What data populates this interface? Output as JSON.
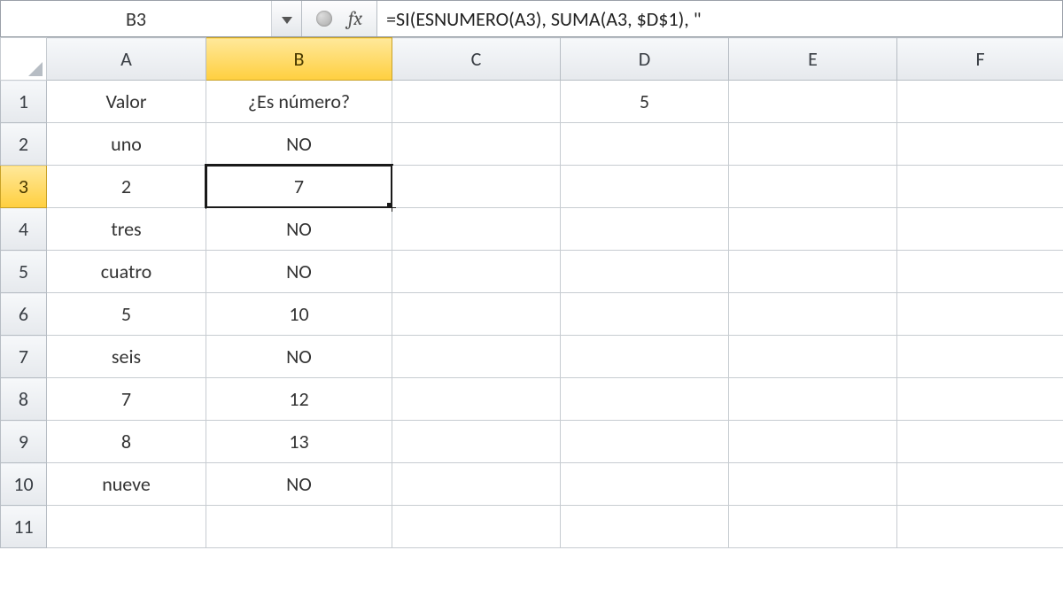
{
  "name_box": "B3",
  "fx_label": "fx",
  "formula": "=SI(ESNUMERO(A3), SUMA(A3, $D$1), \"",
  "columns": [
    "A",
    "B",
    "C",
    "D",
    "E",
    "F"
  ],
  "active_column": "B",
  "active_row": "3",
  "rows": [
    "1",
    "2",
    "3",
    "4",
    "5",
    "6",
    "7",
    "8",
    "9",
    "10",
    "11"
  ],
  "cells": {
    "A1": "Valor",
    "B1": "¿Es número?",
    "D1": "5",
    "A2": "uno",
    "B2": "NO",
    "A3": "2",
    "B3": "7",
    "A4": "tres",
    "B4": "NO",
    "A5": "cuatro",
    "B5": "NO",
    "A6": "5",
    "B6": "10",
    "A7": "seis",
    "B7": "NO",
    "A8": "7",
    "B8": "12",
    "A9": "8",
    "B9": "13",
    "A10": "nueve",
    "B10": "NO"
  }
}
